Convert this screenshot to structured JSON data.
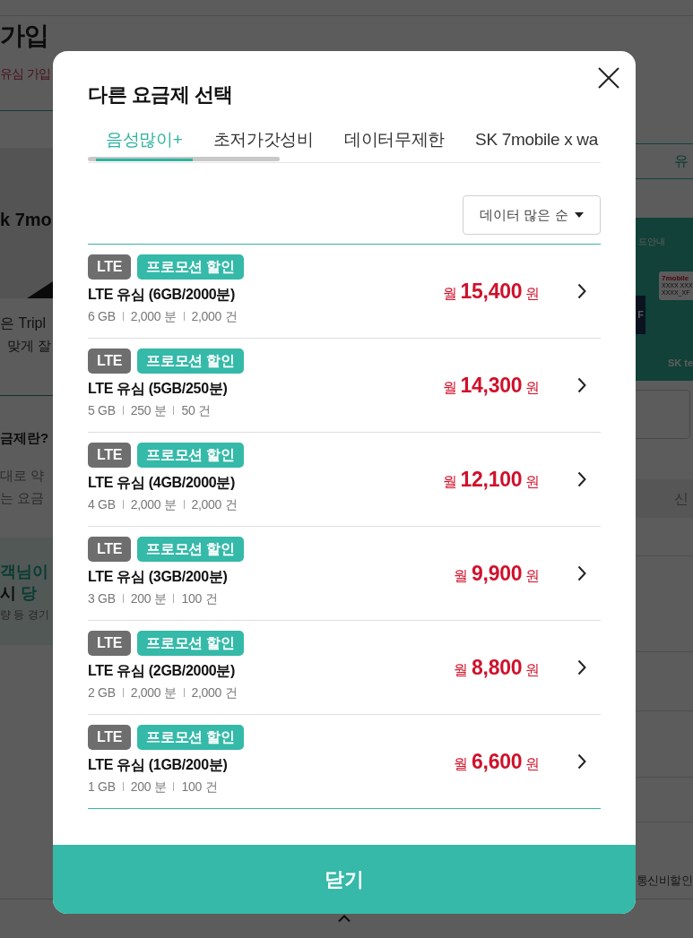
{
  "background": {
    "left": {
      "title": "가입",
      "subtitle": "유심 가입",
      "banner_logo": "k 7mo",
      "intro": [
        "은 Tripl",
        "맞게 잘"
      ],
      "question": "금제란?",
      "answer": [
        "대로 약",
        "는 요금"
      ],
      "promo_lines": [
        [
          {
            "text": "객님이",
            "accent": true
          }
        ],
        [
          {
            "text": "시",
            "accent": false
          },
          {
            "text": "당",
            "accent": true
          }
        ],
        [
          {
            "text": "량 등 경기",
            "accent": false
          }
        ]
      ]
    },
    "right": {
      "tab": "유",
      "banner_caption": "드안내",
      "card_lines": [
        "7mobile",
        "XXXX XXX",
        "XXXX_XF"
      ],
      "banner_badge": "F",
      "banner_logo": "SK te",
      "table_header": "신",
      "footer_text": "통신비할인"
    }
  },
  "modal": {
    "title": "다른 요금제 선택",
    "tabs": [
      {
        "label": "음성많이+",
        "selected": true
      },
      {
        "label": "초저가갓성비",
        "selected": false
      },
      {
        "label": "데이터무제한",
        "selected": false
      },
      {
        "label": "SK 7mobile x wa",
        "selected": false
      }
    ],
    "sort": {
      "label": "데이터 많은 순"
    },
    "plans": [
      {
        "badges": [
          {
            "text": "LTE",
            "kind": "network"
          },
          {
            "text": "프로모션 할인",
            "kind": "promotion"
          }
        ],
        "name": "LTE 유심 (6GB/2000분)",
        "specs": [
          "6 GB",
          "2,000 분",
          "2,000 건"
        ],
        "price": "월 **15,400** 원"
      },
      {
        "badges": [
          {
            "text": "LTE",
            "kind": "network"
          },
          {
            "text": "프로모션 할인",
            "kind": "promotion"
          }
        ],
        "name": "LTE 유심 (5GB/250분)",
        "specs": [
          "5 GB",
          "250 분",
          "50 건"
        ],
        "price": "월 **14,300** 원"
      },
      {
        "badges": [
          {
            "text": "LTE",
            "kind": "network"
          },
          {
            "text": "프로모션 할인",
            "kind": "promotion"
          }
        ],
        "name": "LTE 유심 (4GB/2000분)",
        "specs": [
          "4 GB",
          "2,000 분",
          "2,000 건"
        ],
        "price": "월 **12,100** 원"
      },
      {
        "badges": [
          {
            "text": "LTE",
            "kind": "network"
          },
          {
            "text": "프로모션 할인",
            "kind": "promotion"
          }
        ],
        "name": "LTE 유심 (3GB/200분)",
        "specs": [
          "3 GB",
          "200 분",
          "100 건"
        ],
        "price": "월 **9,900** 원"
      },
      {
        "badges": [
          {
            "text": "LTE",
            "kind": "network"
          },
          {
            "text": "프로모션 할인",
            "kind": "promotion"
          }
        ],
        "name": "LTE 유심 (2GB/2000분)",
        "specs": [
          "2 GB",
          "2,000 분",
          "2,000 건"
        ],
        "price": "월 **8,800** 원"
      },
      {
        "badges": [
          {
            "text": "LTE",
            "kind": "network"
          },
          {
            "text": "프로모션 할인",
            "kind": "promotion"
          }
        ],
        "name": "LTE 유심 (1GB/200분)",
        "specs": [
          "1 GB",
          "200 분",
          "100 건"
        ],
        "price": "월 **6,600** 원"
      }
    ],
    "close_button": "닫기"
  }
}
